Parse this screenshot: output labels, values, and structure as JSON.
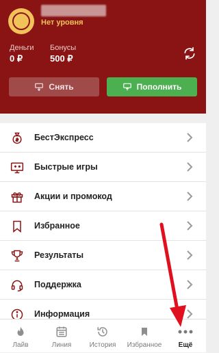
{
  "profile": {
    "level": "Нет уровня"
  },
  "balances": [
    {
      "label": "Деньги",
      "value": "0 ₽"
    },
    {
      "label": "Бонусы",
      "value": "500 ₽"
    }
  ],
  "actions": {
    "withdraw": "Снять",
    "deposit": "Пополнить"
  },
  "menu": [
    {
      "label": "БестЭкспресс",
      "icon": "moneybag-icon"
    },
    {
      "label": "Быстрые игры",
      "icon": "monitor-game-icon"
    },
    {
      "label": "Акции и промокод",
      "icon": "gift-icon"
    },
    {
      "label": "Избранное",
      "icon": "bookmark-icon"
    },
    {
      "label": "Результаты",
      "icon": "trophy-icon"
    },
    {
      "label": "Поддержка",
      "icon": "headset-icon"
    },
    {
      "label": "Информация",
      "icon": "info-icon"
    }
  ],
  "tabs": [
    {
      "label": "Лайв",
      "icon": "flame-icon"
    },
    {
      "label": "Линия",
      "icon": "calendar-icon"
    },
    {
      "label": "История",
      "icon": "history-icon"
    },
    {
      "label": "Избранное",
      "icon": "bookmark-icon"
    },
    {
      "label": "Ещё",
      "icon": "more-dots-icon",
      "active": true
    }
  ],
  "colors": {
    "header": "#8a1414",
    "accent": "#a01c1c",
    "deposit": "#4caf50",
    "level": "#f1c15a",
    "arrow": "#e0101e"
  }
}
